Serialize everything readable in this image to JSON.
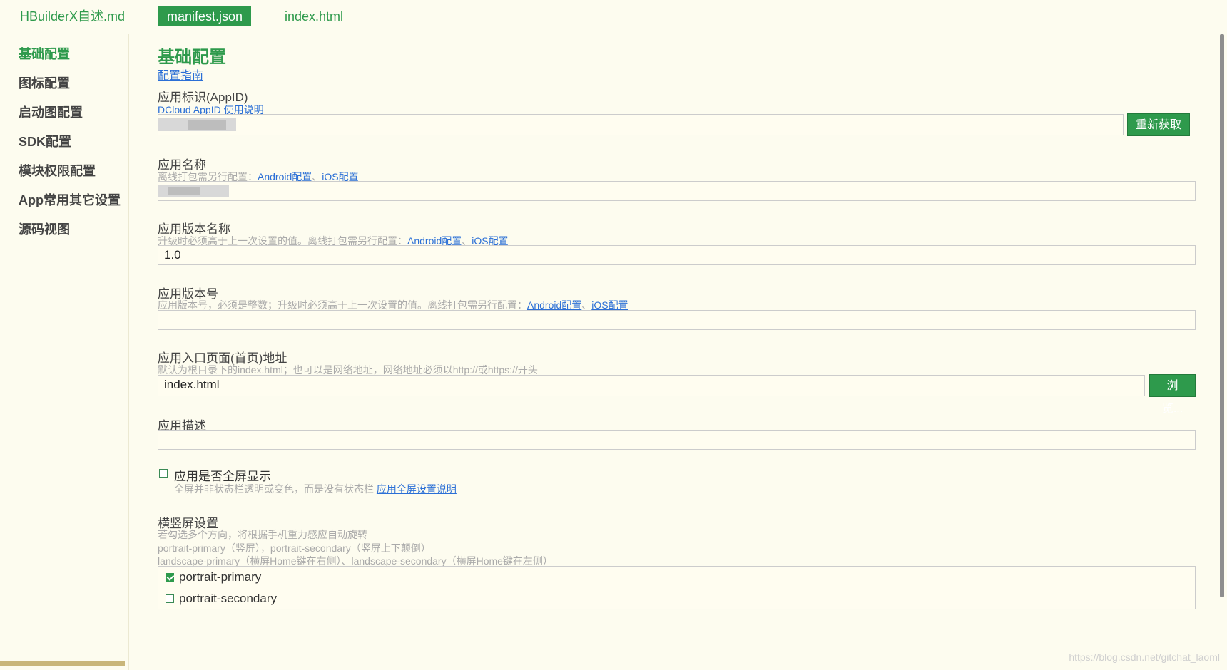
{
  "tabs": [
    {
      "label": "HBuilderX自述.md",
      "active": false
    },
    {
      "label": "manifest.json",
      "active": true
    },
    {
      "label": "index.html",
      "active": false
    }
  ],
  "sidebar": {
    "items": [
      {
        "label": "基础配置",
        "active": true
      },
      {
        "label": "图标配置",
        "active": false
      },
      {
        "label": "启动图配置",
        "active": false
      },
      {
        "label": "SDK配置",
        "active": false
      },
      {
        "label": "模块权限配置",
        "active": false
      },
      {
        "label": "App常用其它设置",
        "active": false
      },
      {
        "label": "源码视图",
        "active": false
      }
    ]
  },
  "main": {
    "title": "基础配置",
    "guide_link": "配置指南",
    "appid": {
      "label": "应用标识(AppID)",
      "doc_link": "DCloud AppID 使用说明",
      "value": "",
      "button": "重新获取"
    },
    "app_name": {
      "label": "应用名称",
      "hint_prefix": "离线打包需另行配置：",
      "android_link": "Android配置",
      "sep": "、",
      "ios_link": "iOS配置",
      "value": ""
    },
    "version_name": {
      "label": "应用版本名称",
      "hint_prefix": "升级时必须高于上一次设置的值。离线打包需另行配置：",
      "android_link": "Android配置",
      "sep": "、",
      "ios_link": "iOS配置",
      "value": "1.0"
    },
    "version_code": {
      "label": "应用版本号",
      "hint_prefix": "应用版本号，必须是整数；升级时必须高于上一次设置的值。离线打包需另行配置：",
      "android_link": "Android配置",
      "sep": "、",
      "ios_link": "iOS配置",
      "value": ""
    },
    "entry_page": {
      "label": "应用入口页面(首页)地址",
      "hint": "默认为根目录下的index.html；也可以是网络地址，网络地址必须以http://或https://开头",
      "value": "index.html",
      "button": "浏览..."
    },
    "description": {
      "label": "应用描述",
      "value": ""
    },
    "fullscreen": {
      "label": "应用是否全屏显示",
      "checked": false,
      "hint_prefix": "全屏并非状态栏透明或变色，而是没有状态栏 ",
      "link": "应用全屏设置说明"
    },
    "orientation": {
      "label": "横竖屏设置",
      "hint_lines": [
        "若勾选多个方向，将根据手机重力感应自动旋转",
        "portrait-primary（竖屏），portrait-secondary（竖屏上下颠倒）",
        "landscape-primary（横屏Home键在右侧）、landscape-secondary（横屏Home键在左侧）"
      ],
      "options": [
        {
          "label": "portrait-primary",
          "checked": true
        },
        {
          "label": "portrait-secondary",
          "checked": false
        }
      ]
    }
  },
  "watermark": "https://blog.csdn.net/gitchat_laoml",
  "colors": {
    "accent": "#2e9a4c",
    "background": "#fdfcef",
    "link": "#2b6fd6"
  }
}
